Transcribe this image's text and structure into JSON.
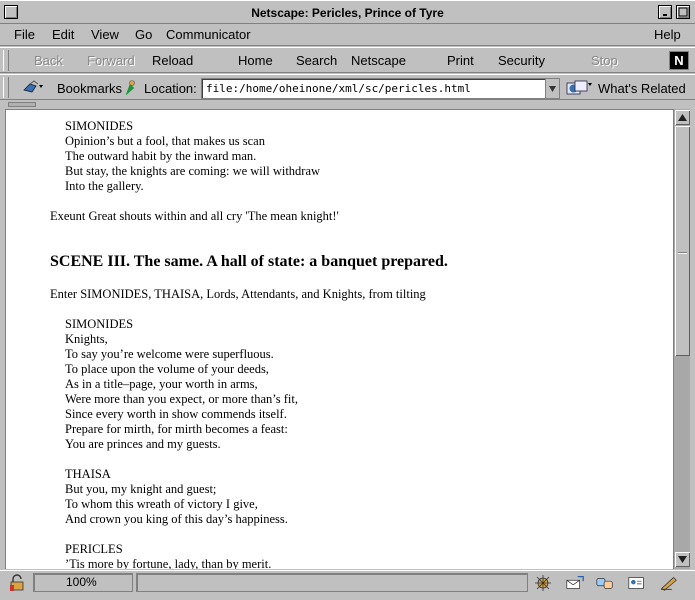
{
  "window": {
    "title": "Netscape: Pericles, Prince of Tyre"
  },
  "menubar": {
    "items": [
      "File",
      "Edit",
      "View",
      "Go",
      "Communicator",
      "Help"
    ]
  },
  "navbar": {
    "back": "Back",
    "forward": "Forward",
    "reload": "Reload",
    "home": "Home",
    "search": "Search",
    "netscape": "Netscape",
    "print": "Print",
    "security": "Security",
    "stop": "Stop",
    "logo": "N"
  },
  "locbar": {
    "bookmarks": "Bookmarks",
    "location_label": "Location:",
    "url": "file:/home/oheinone/xml/sc/pericles.html",
    "related": "What's Related"
  },
  "content": {
    "speech1": {
      "speaker": "SIMONIDES",
      "lines": [
        "Opinion’s but a fool, that makes us scan",
        "The outward habit by the inward man.",
        "But stay, the knights are coming: we will withdraw",
        "Into the gallery."
      ]
    },
    "stage1": "Exeunt Great shouts within and all cry 'The mean knight!'",
    "scene_title": "SCENE III. The same. A hall of state: a banquet prepared.",
    "stage2": "Enter SIMONIDES, THAISA, Lords, Attendants, and Knights, from tilting",
    "speech2": {
      "speaker": "SIMONIDES",
      "lines": [
        "Knights,",
        "To say you’re welcome were superfluous.",
        "To place upon the volume of your deeds,",
        "As in a title–page, your worth in arms,",
        "Were more than you expect, or more than’s fit,",
        "Since every worth in show commends itself.",
        "Prepare for mirth, for mirth becomes a feast:",
        "You are princes and my guests."
      ]
    },
    "speech3": {
      "speaker": "THAISA",
      "lines": [
        "But you, my knight and guest;",
        "To whom this wreath of victory I give,",
        "And crown you king of this day’s happiness."
      ]
    },
    "speech4": {
      "speaker": "PERICLES",
      "lines": [
        "’Tis more by fortune, lady, than by merit."
      ]
    }
  },
  "statusbar": {
    "zoom": "100%"
  }
}
